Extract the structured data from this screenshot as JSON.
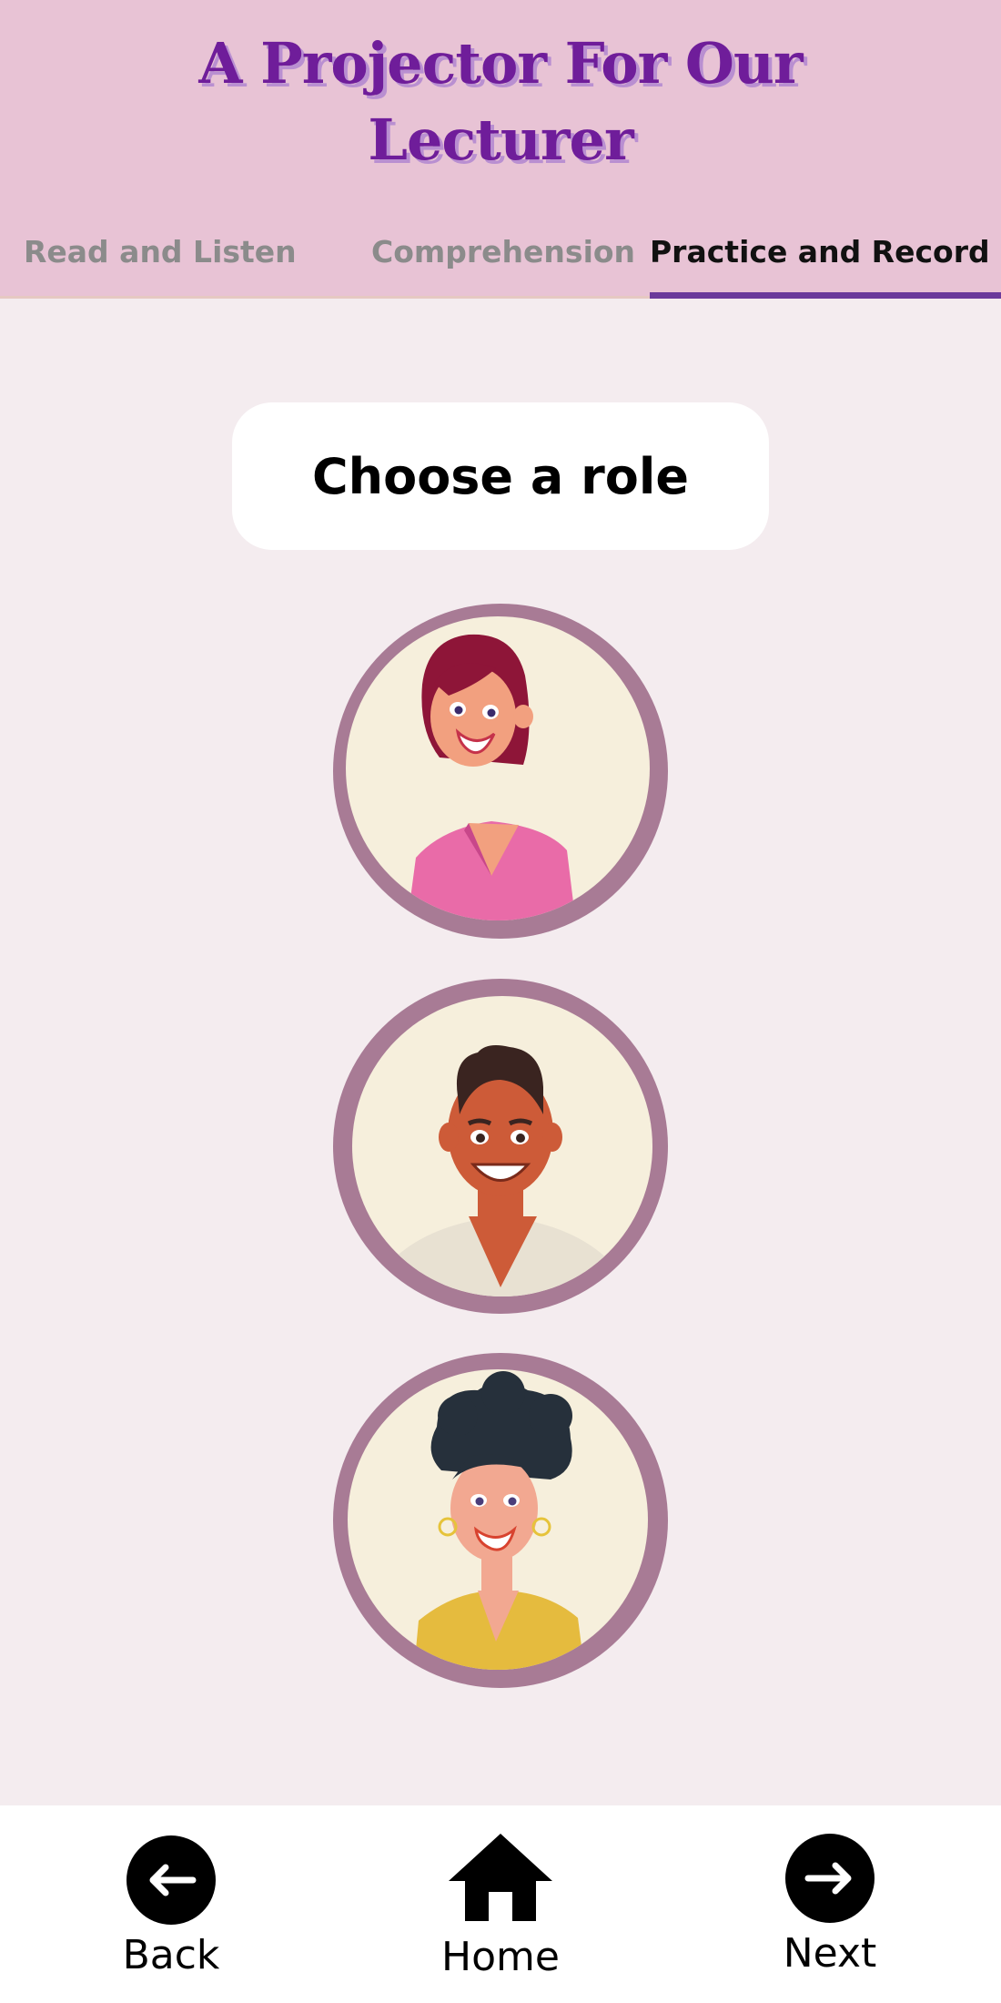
{
  "header": {
    "title_line1": "A Projector For Our",
    "title_line2": "Lecturer"
  },
  "tabs": [
    {
      "label": "Read and Listen",
      "active": false
    },
    {
      "label": "Comprehension",
      "active": false
    },
    {
      "label": "Practice and Record",
      "active": true
    }
  ],
  "main": {
    "prompt": "Choose a role",
    "roles": [
      {
        "icon": "woman-red-hair-pink-top-avatar-icon"
      },
      {
        "icon": "man-dark-skin-avatar-icon"
      },
      {
        "icon": "woman-curly-hair-yellow-top-avatar-icon"
      }
    ]
  },
  "footer": {
    "back_label": "Back",
    "home_label": "Home",
    "next_label": "Next"
  },
  "colors": {
    "header_bg": "#e8c3d5",
    "title": "#6f1d9a",
    "active_tab_underline": "#6b3a9b",
    "page_bg": "#f4ecef",
    "avatar_ring": "#a87b95",
    "avatar_fill": "#f6efdc"
  }
}
